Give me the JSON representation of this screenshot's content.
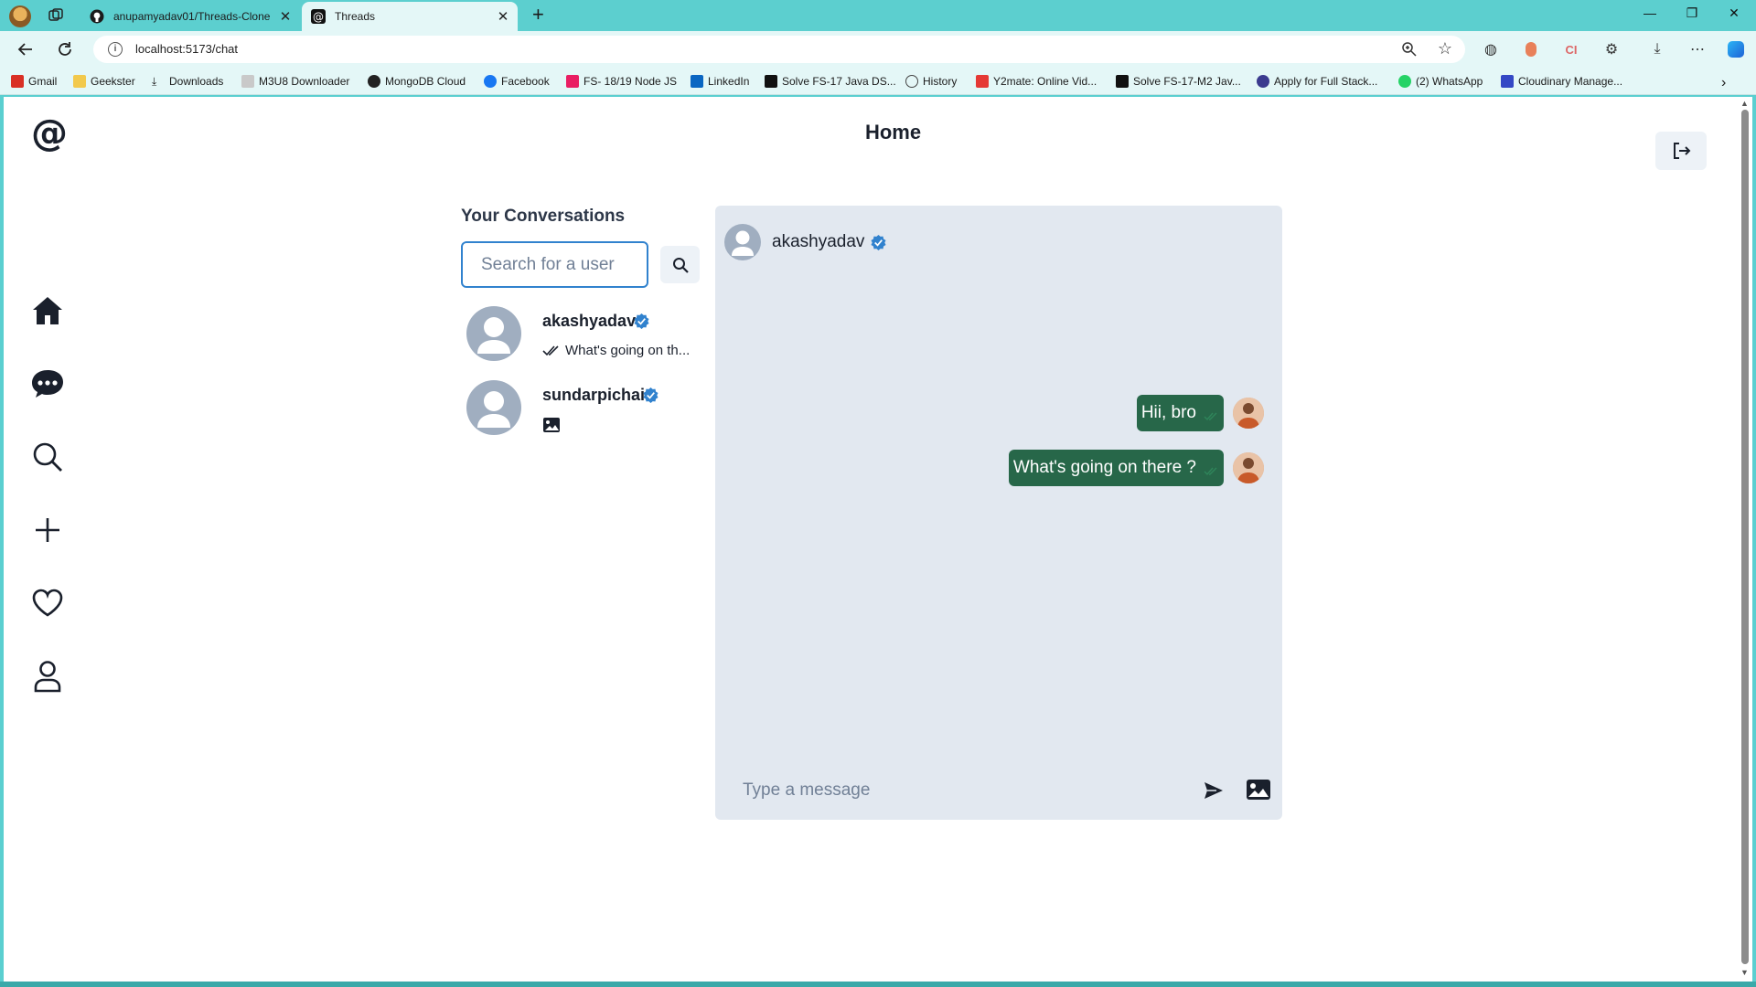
{
  "browser": {
    "tabs": [
      {
        "label": "anupamyadav01/Threads-Clone",
        "icon": "github-icon"
      },
      {
        "label": "Threads",
        "icon": "threads-icon"
      }
    ],
    "new_tab": "+",
    "url": "localhost:5173/chat",
    "bookmarks": [
      {
        "label": "Gmail",
        "color": "#d93025"
      },
      {
        "label": "Geekster",
        "color": "#f2c94c"
      },
      {
        "label": "Downloads",
        "color": "#333333"
      },
      {
        "label": "M3U8 Downloader",
        "color": "#c9c9c9"
      },
      {
        "label": "MongoDB Cloud",
        "color": "#222222"
      },
      {
        "label": "Facebook",
        "color": "#1877f2"
      },
      {
        "label": "FS- 18/19 Node JS",
        "color": "#e91e63"
      },
      {
        "label": "LinkedIn",
        "color": "#0a66c2"
      },
      {
        "label": "Solve FS-17 Java DS...",
        "color": "#111111"
      },
      {
        "label": "History",
        "color": "#444444"
      },
      {
        "label": "Y2mate: Online Vid...",
        "color": "#e53935"
      },
      {
        "label": "Solve FS-17-M2 Jav...",
        "color": "#111111"
      },
      {
        "label": "Apply for Full Stack...",
        "color": "#3b3b8f"
      },
      {
        "label": "(2) WhatsApp",
        "color": "#25d366"
      },
      {
        "label": "Cloudinary Manage...",
        "color": "#3448c5"
      }
    ]
  },
  "app": {
    "page_title": "Home",
    "nav": [
      "home-icon",
      "chat-icon",
      "search-icon",
      "plus-icon",
      "heart-icon",
      "profile-icon"
    ],
    "conversations": {
      "title": "Your Conversations",
      "search_placeholder": "Search for a user",
      "items": [
        {
          "username": "akashyadav",
          "preview": "What's going on th...",
          "verified": true,
          "preview_type": "text"
        },
        {
          "username": "sundarpichai",
          "preview": "",
          "verified": true,
          "preview_type": "image"
        }
      ]
    },
    "chat": {
      "username": "akashyadav",
      "verified": true,
      "messages": [
        {
          "text": "Hii, bro",
          "seen": true
        },
        {
          "text": "What's going on there ?",
          "seen": true
        }
      ],
      "input_placeholder": "Type a message"
    },
    "colors": {
      "accent": "#3182ce",
      "message_bubble": "#276749",
      "chat_bg": "#e2e8f0",
      "verified": "#3182ce"
    }
  }
}
